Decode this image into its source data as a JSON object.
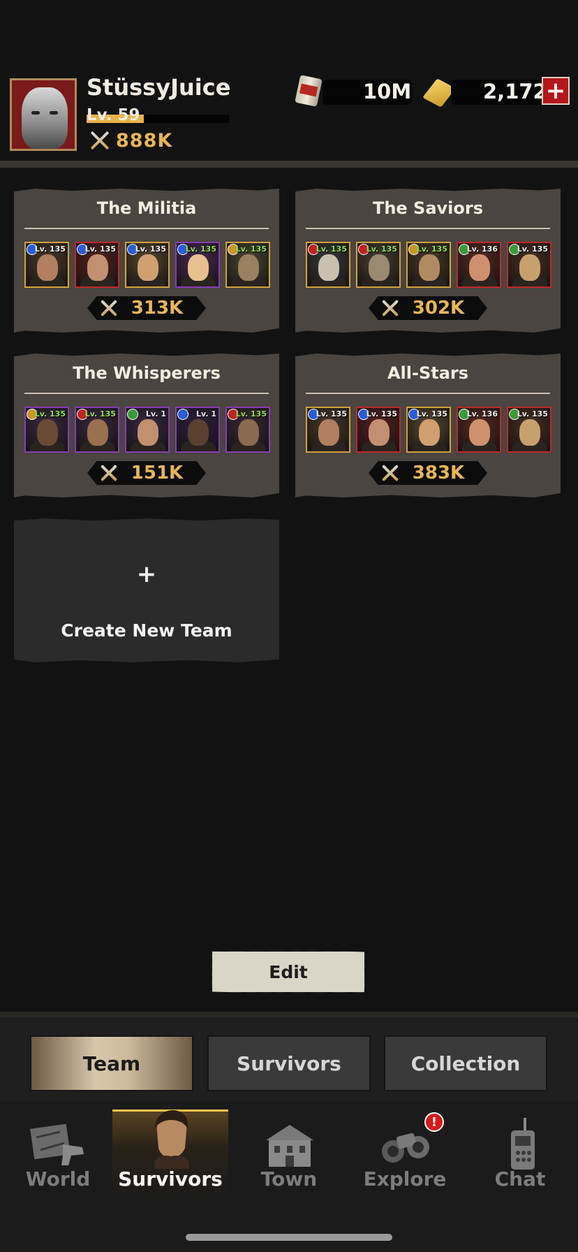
{
  "player": {
    "name": "StüssyJuice",
    "level": "Lv. 59",
    "level_progress": 0.4,
    "power": "888K"
  },
  "currencies": [
    {
      "icon": "can-icon",
      "value": "10M"
    },
    {
      "icon": "gold-bar-icon",
      "value": "2,172"
    }
  ],
  "teams": [
    {
      "name": "The Militia",
      "power": "313K",
      "members": [
        {
          "level": "Lv. 135",
          "level_color": "white",
          "emblem": "blue",
          "frame": "gold",
          "bg": "#4a3a2a",
          "skin": "#b08060"
        },
        {
          "level": "Lv. 135",
          "level_color": "white",
          "emblem": "blue",
          "frame": "red",
          "bg": "#5a2020",
          "skin": "#c29070"
        },
        {
          "level": "Lv. 135",
          "level_color": "white",
          "emblem": "blue",
          "frame": "gold",
          "bg": "#5a4a30",
          "skin": "#d0a070"
        },
        {
          "level": "Lv. 135",
          "level_color": "green",
          "emblem": "blue",
          "frame": "purple",
          "bg": "#4a2a55",
          "skin": "#e8c090"
        },
        {
          "level": "Lv. 135",
          "level_color": "green",
          "emblem": "gold",
          "frame": "gold",
          "bg": "#4a4a35",
          "skin": "#9a8060"
        }
      ]
    },
    {
      "name": "The Saviors",
      "power": "302K",
      "members": [
        {
          "level": "Lv. 135",
          "level_color": "green",
          "emblem": "red",
          "frame": "gold",
          "bg": "#3a3a3a",
          "skin": "#c8c0b0"
        },
        {
          "level": "Lv. 135",
          "level_color": "green",
          "emblem": "red",
          "frame": "gold",
          "bg": "#4a4035",
          "skin": "#9a8a70"
        },
        {
          "level": "Lv. 135",
          "level_color": "green",
          "emblem": "gold",
          "frame": "gold",
          "bg": "#4a3a28",
          "skin": "#b08a60"
        },
        {
          "level": "Lv. 136",
          "level_color": "white",
          "emblem": "green",
          "frame": "red",
          "bg": "#5a2a22",
          "skin": "#d09070"
        },
        {
          "level": "Lv. 135",
          "level_color": "white",
          "emblem": "green",
          "frame": "red",
          "bg": "#4a3020",
          "skin": "#c8a070"
        }
      ]
    },
    {
      "name": "The Whisperers",
      "power": "151K",
      "members": [
        {
          "level": "Lv. 135",
          "level_color": "green",
          "emblem": "gold",
          "frame": "purple",
          "bg": "#3a2a45",
          "skin": "#6a4a35"
        },
        {
          "level": "Lv. 135",
          "level_color": "green",
          "emblem": "red",
          "frame": "purple",
          "bg": "#3a2a40",
          "skin": "#9a7050"
        },
        {
          "level": "Lv. 1",
          "level_color": "white",
          "emblem": "green",
          "frame": "purple",
          "bg": "#3a2a45",
          "skin": "#c09070"
        },
        {
          "level": "Lv. 1",
          "level_color": "white",
          "emblem": "blue",
          "frame": "purple",
          "bg": "#302040",
          "skin": "#5a4030"
        },
        {
          "level": "Lv. 135",
          "level_color": "green",
          "emblem": "red",
          "frame": "purple",
          "bg": "#3a2838",
          "skin": "#8a6a50"
        }
      ]
    },
    {
      "name": "All-Stars",
      "power": "383K",
      "members": [
        {
          "level": "Lv. 135",
          "level_color": "white",
          "emblem": "blue",
          "frame": "gold",
          "bg": "#4a3a2a",
          "skin": "#b08060"
        },
        {
          "level": "Lv. 135",
          "level_color": "white",
          "emblem": "blue",
          "frame": "red",
          "bg": "#5a2020",
          "skin": "#c29070"
        },
        {
          "level": "Lv. 135",
          "level_color": "white",
          "emblem": "blue",
          "frame": "gold",
          "bg": "#5a4a30",
          "skin": "#d0a070"
        },
        {
          "level": "Lv. 136",
          "level_color": "white",
          "emblem": "green",
          "frame": "red",
          "bg": "#5a2a22",
          "skin": "#d09070"
        },
        {
          "level": "Lv. 135",
          "level_color": "white",
          "emblem": "green",
          "frame": "red",
          "bg": "#4a3020",
          "skin": "#c8a070"
        }
      ]
    }
  ],
  "create_team": {
    "icon": "plus-icon",
    "plus": "+",
    "label": "Create New Team"
  },
  "edit_label": "Edit",
  "subtabs": [
    {
      "label": "Team",
      "active": true
    },
    {
      "label": "Survivors",
      "active": false
    },
    {
      "label": "Collection",
      "active": false
    }
  ],
  "nav": [
    {
      "label": "World",
      "icon": "world-icon",
      "active": false
    },
    {
      "label": "Survivors",
      "icon": "survivors-icon",
      "active": true
    },
    {
      "label": "Town",
      "icon": "town-icon",
      "active": false
    },
    {
      "label": "Explore",
      "icon": "binoculars-icon",
      "active": false,
      "badge": "!"
    },
    {
      "label": "Chat",
      "icon": "chat-radio-icon",
      "active": false
    }
  ],
  "colors": {
    "accent_gold": "#e8b658",
    "active_tab_border": "#f5c24a",
    "badge_red": "#d41a1a"
  }
}
